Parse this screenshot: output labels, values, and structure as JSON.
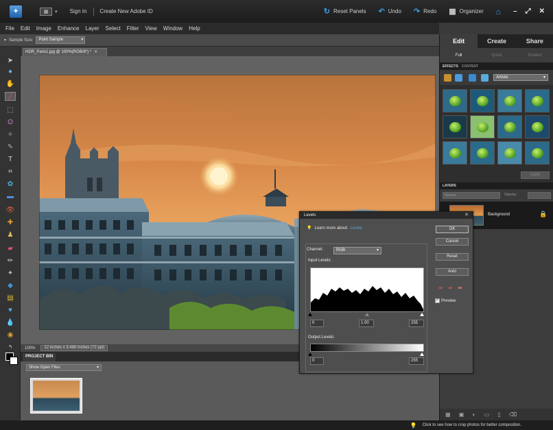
{
  "titlebar": {
    "sign_in": "Sign In",
    "create_id": "Create New Adobe ID",
    "reset_panels": "Reset Panels",
    "undo": "Undo",
    "redo": "Redo",
    "organizer": "Organizer"
  },
  "menu": [
    "File",
    "Edit",
    "Image",
    "Enhance",
    "Layer",
    "Select",
    "Filter",
    "View",
    "Window",
    "Help"
  ],
  "options": {
    "sample_size_label": "Sample Size:",
    "sample_size_value": "Point Sample"
  },
  "document": {
    "tab_title": "HDR_Paris1.jpg @ 100%(RGB/8*) *",
    "zoom": "100%",
    "dimensions": "12 inches x 3.480 inches (72 ppi)"
  },
  "project_bin": {
    "title": "PROJECT BIN",
    "show_label": "Show Open Files"
  },
  "hint": "Click to see how to crop photos for better composition.",
  "right_panel": {
    "tabs": [
      "Edit",
      "Create",
      "Share"
    ],
    "subtabs": [
      "Full",
      "Quick",
      "Guided"
    ],
    "effects_head": "EFFECTS",
    "content_head": "CONTENT",
    "effects_filter": "Artistic",
    "apply_label": "Apply",
    "layers_head": "LAYERS",
    "blend_mode": "Normal",
    "opacity_label": "Opacity:",
    "layer_name": "Background"
  },
  "levels": {
    "title": "Levels",
    "learn_label": "Learn more about:",
    "learn_link": "Levels",
    "buttons": {
      "ok": "OK",
      "cancel": "Cancel",
      "reset": "Reset",
      "auto": "Auto"
    },
    "channel_label": "Channel:",
    "channel_value": "RGB",
    "input_levels_label": "Input Levels:",
    "input_black": "0",
    "input_gamma": "1.00",
    "input_white": "255",
    "output_levels_label": "Output Levels:",
    "output_black": "0",
    "output_white": "255",
    "preview_label": "Preview",
    "preview_checked": true
  }
}
